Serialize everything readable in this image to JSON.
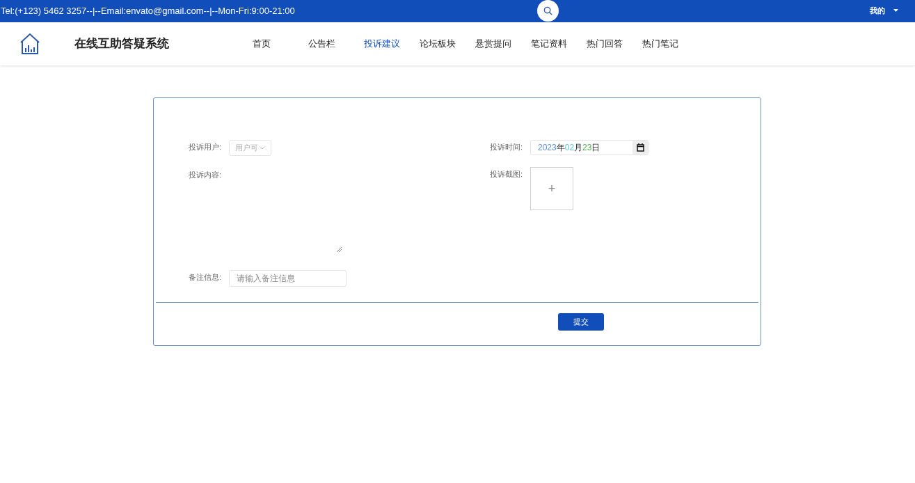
{
  "top_bar": {
    "contact": "Tel:(+123) 5462 3257--|--Email:envato@gmail.com--|--Mon-Fri:9:00-21:00",
    "user_menu": "我的"
  },
  "header": {
    "site_title": "在线互助答疑系统",
    "nav": [
      {
        "label": "首页",
        "selected": false
      },
      {
        "label": "公告栏",
        "selected": false
      },
      {
        "label": "投诉建议",
        "selected": true
      },
      {
        "label": "论坛板块",
        "selected": false
      },
      {
        "label": "悬赏提问",
        "selected": false
      },
      {
        "label": "笔记资料",
        "selected": false
      },
      {
        "label": "热门回答",
        "selected": false
      },
      {
        "label": "热门笔记",
        "selected": false
      }
    ]
  },
  "form": {
    "user": {
      "label": "投诉用户:",
      "value": "用户可"
    },
    "time": {
      "label": "投诉时间:",
      "parts": [
        {
          "text": "2023",
          "color": "#5b8fd6"
        },
        {
          "text": "年"
        },
        {
          "text": "02",
          "color": "#5bc0eb"
        },
        {
          "text": "月"
        },
        {
          "text": "23",
          "color": "#4caf50"
        },
        {
          "text": "日"
        }
      ]
    },
    "content": {
      "label": "投诉内容:"
    },
    "screenshot": {
      "label": "投诉截图:",
      "upload": "+"
    },
    "remark": {
      "label": "备注信息:",
      "placeholder": "请输入备注信息"
    },
    "submit": "提交"
  }
}
